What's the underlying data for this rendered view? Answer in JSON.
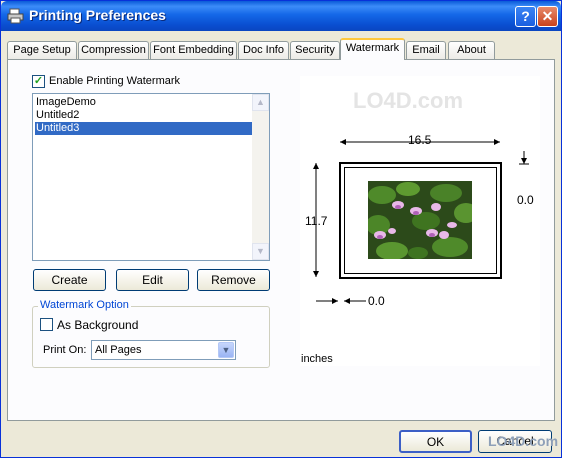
{
  "window": {
    "title": "Printing Preferences",
    "help_label": "?",
    "close_label": "✕"
  },
  "tabs": [
    {
      "label": "Page Setup"
    },
    {
      "label": "Compression"
    },
    {
      "label": "Font Embedding"
    },
    {
      "label": "Doc Info"
    },
    {
      "label": "Security"
    },
    {
      "label": "Watermark",
      "active": true
    },
    {
      "label": "Email"
    },
    {
      "label": "About"
    }
  ],
  "watermark": {
    "enable_label": "Enable Printing Watermark",
    "enable_checked": true,
    "enable_check_glyph": "✓",
    "list_items": [
      "ImageDemo",
      "Untitled2",
      "Untitled3"
    ],
    "selected_index": 2,
    "create_label": "Create",
    "edit_label": "Edit",
    "remove_label": "Remove",
    "option_group_title": "Watermark Option",
    "as_background_label": "As Background",
    "as_background_checked": false,
    "print_on_label": "Print On:",
    "print_on_value": "All Pages"
  },
  "preview": {
    "width_value": "16.5",
    "height_value": "11.7",
    "top_offset_value": "0.0",
    "left_offset_value": "0.0",
    "units_label": "inches",
    "logo_text": "LO4D.com"
  },
  "footer": {
    "ok_label": "OK",
    "cancel_label": "Cancel",
    "site_mark": "LO4D.com"
  },
  "colors": {
    "titlebar": "#0a5ad8",
    "selection": "#316ac5",
    "active_tab_accent": "#ffc83c"
  }
}
